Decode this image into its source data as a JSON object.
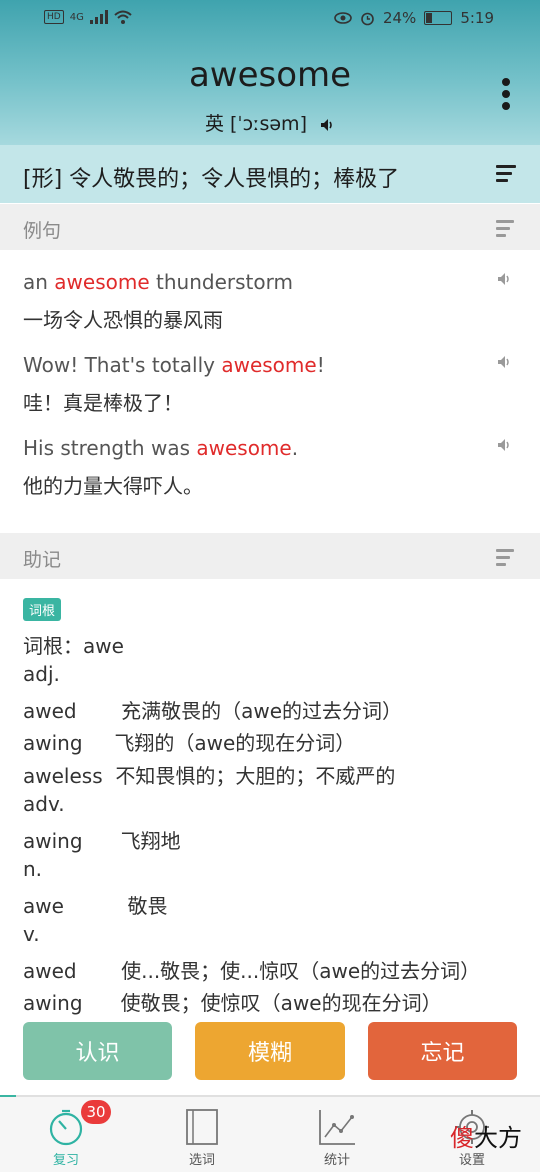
{
  "status_bar": {
    "network": "4G",
    "battery": "24%",
    "time": "5:19"
  },
  "header": {
    "word": "awesome",
    "phonetic": "英 [ˈɔːsəm]"
  },
  "meaning": "[形] 令人敬畏的；令人畏惧的；棒极了",
  "examples_section": {
    "title": "例句",
    "items": [
      {
        "en_pre": "an ",
        "en_hl": "awesome",
        "en_post": " thunderstorm",
        "cn": "一场令人恐惧的暴风雨"
      },
      {
        "en_pre": "Wow! That's totally ",
        "en_hl": "awesome",
        "en_post": "!",
        "cn": "哇！真是棒极了！"
      },
      {
        "en_pre": "His strength was ",
        "en_hl": "awesome",
        "en_post": ".",
        "cn": "他的力量大得吓人。"
      }
    ]
  },
  "memory_section": {
    "title": "助记",
    "tag": "词根",
    "lines": [
      "词根：awe",
      "adj.",
      "awed       充满敬畏的（awe的过去分词）",
      "awing     飞翔的（awe的现在分词）",
      "aweless  不知畏惧的；大胆的；不威严的",
      "adv.",
      "awing      飞翔地",
      "n.",
      "awe          敬畏",
      "v.",
      "awed       使...敬畏；使...惊叹（awe的过去分词）",
      "awing      使敬畏；使惊叹（awe的现在分词）"
    ]
  },
  "actions": {
    "know": "认识",
    "fuzzy": "模糊",
    "forget": "忘记"
  },
  "colors": {
    "know": "#7fc3a9",
    "fuzzy": "#eda631",
    "forget": "#e2653c"
  },
  "tabs": [
    {
      "label": "复习",
      "icon": "timer-icon",
      "active": true
    },
    {
      "label": "选词",
      "icon": "book-icon"
    },
    {
      "label": "统计",
      "icon": "chart-icon"
    },
    {
      "label": "设置",
      "icon": "gear-icon"
    }
  ],
  "review_badge": "30",
  "watermark": {
    "a": "傻",
    "b": "大方"
  }
}
